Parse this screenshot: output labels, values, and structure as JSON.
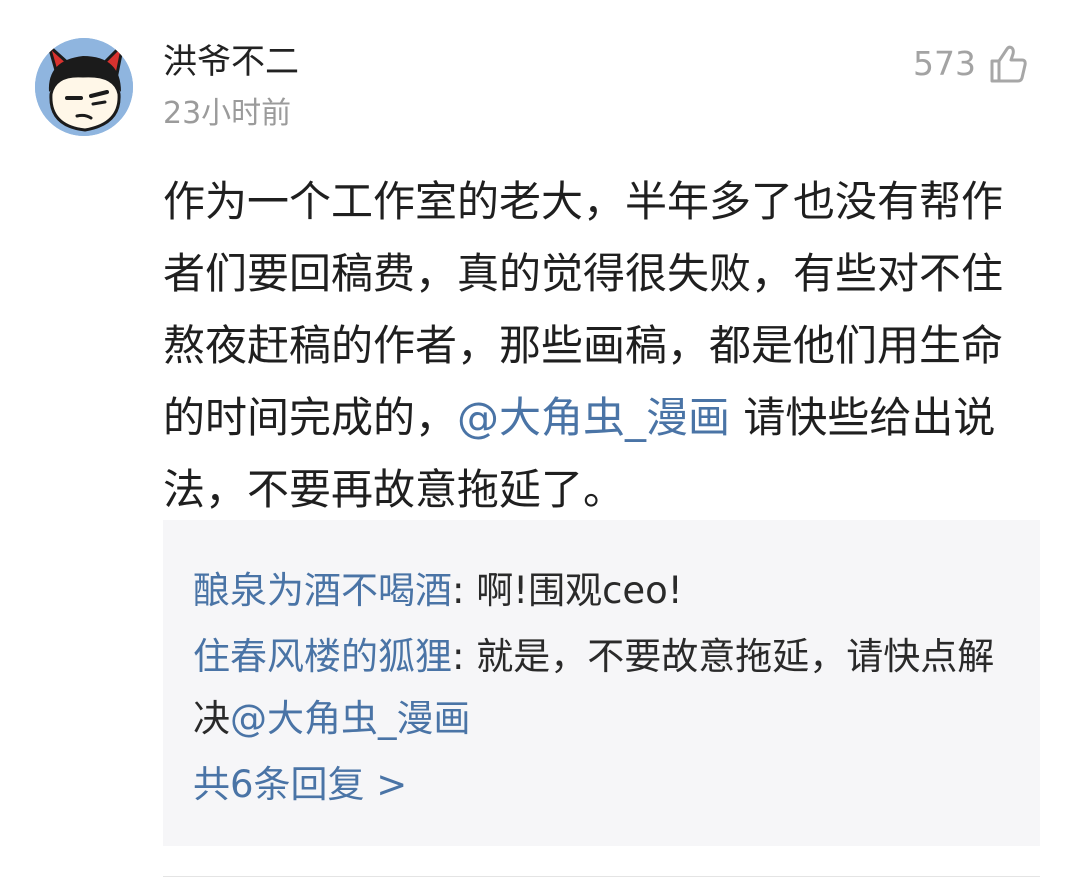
{
  "comment": {
    "username": "洪爷不二",
    "time": "23小时前",
    "like_count": "573",
    "icons": {
      "avatar": "cartoon-avatar",
      "like": "thumbs-up-icon"
    },
    "text_before_mention": "作为一个工作室的老大，半年多了也没有帮作者们要回稿费，真的觉得很失败，有些对不住熬夜赶稿的作者，那些画稿，都是他们用生命的时间完成的，",
    "mention": "@大角虫_漫画",
    "text_after_mention": " 请快些给出说法，不要再故意拖延了。"
  },
  "replies": {
    "items": [
      {
        "name": "酿泉为酒不喝酒",
        "separator": ": ",
        "text": "啊!围观ceo!",
        "mention": ""
      },
      {
        "name": "住春风楼的狐狸",
        "separator": ": ",
        "text": "就是，不要故意拖延，请快点解决",
        "mention": "@大角虫_漫画"
      }
    ],
    "total_label": "共6条回复 >"
  },
  "colors": {
    "link": "#4a74a6",
    "text": "#1f1f1f",
    "muted": "#9b9b9b",
    "reply_background": "#f6f6f8"
  }
}
